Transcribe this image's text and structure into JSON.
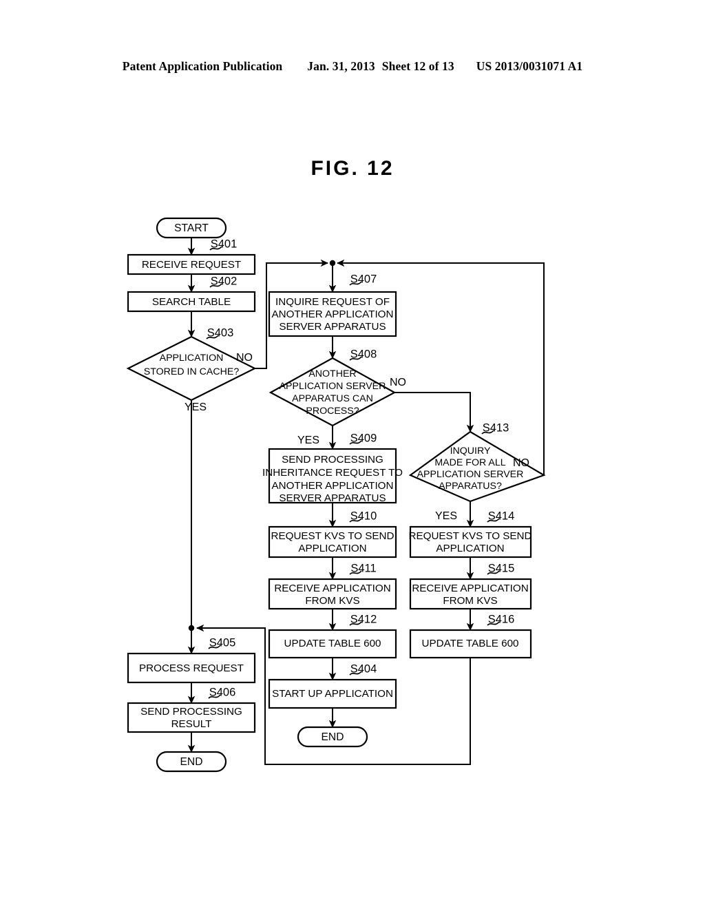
{
  "header": {
    "publication": "Patent Application Publication",
    "date": "Jan. 31, 2013",
    "sheet": "Sheet 12 of 13",
    "pub_number": "US 2013/0031071 A1"
  },
  "figure": {
    "title": "FIG. 12"
  },
  "flowchart": {
    "terminals": {
      "start": "START",
      "end_left": "END",
      "end_middle": "END"
    },
    "yes_no": {
      "yes": "YES",
      "no": "NO"
    },
    "nodes": [
      {
        "id": "S401",
        "step": "S401",
        "type": "process",
        "lines": [
          "RECEIVE REQUEST"
        ]
      },
      {
        "id": "S402",
        "step": "S402",
        "type": "process",
        "lines": [
          "SEARCH TABLE"
        ]
      },
      {
        "id": "S403",
        "step": "S403",
        "type": "decision",
        "lines": [
          "APPLICATION",
          "STORED IN CACHE?"
        ]
      },
      {
        "id": "S405",
        "step": "S405",
        "type": "process",
        "lines": [
          "PROCESS REQUEST"
        ]
      },
      {
        "id": "S406",
        "step": "S406",
        "type": "process",
        "lines": [
          "SEND PROCESSING",
          "RESULT"
        ]
      },
      {
        "id": "S407",
        "step": "S407",
        "type": "process",
        "lines": [
          "INQUIRE REQUEST OF",
          "ANOTHER APPLICATION",
          "SERVER APPARATUS"
        ]
      },
      {
        "id": "S408",
        "step": "S408",
        "type": "decision",
        "lines": [
          "ANOTHER",
          "APPLICATION SERVER",
          "APPARATUS CAN",
          "PROCESS?"
        ]
      },
      {
        "id": "S409",
        "step": "S409",
        "type": "process",
        "lines": [
          "SEND PROCESSING",
          "INHERITANCE REQUEST TO",
          "ANOTHER APPLICATION",
          "SERVER APPARATUS"
        ]
      },
      {
        "id": "S410",
        "step": "S410",
        "type": "process",
        "lines": [
          "REQUEST KVS TO SEND",
          "APPLICATION"
        ]
      },
      {
        "id": "S411",
        "step": "S411",
        "type": "process",
        "lines": [
          "RECEIVE APPLICATION",
          "FROM KVS"
        ]
      },
      {
        "id": "S412",
        "step": "S412",
        "type": "process",
        "lines": [
          "UPDATE TABLE 600"
        ]
      },
      {
        "id": "S404",
        "step": "S404",
        "type": "process",
        "lines": [
          "START UP APPLICATION"
        ]
      },
      {
        "id": "S413",
        "step": "S413",
        "type": "decision",
        "lines": [
          "INQUIRY",
          "MADE FOR ALL",
          "APPLICATION SERVER",
          "APPARATUS?"
        ]
      },
      {
        "id": "S414",
        "step": "S414",
        "type": "process",
        "lines": [
          "REQUEST KVS TO SEND",
          "APPLICATION"
        ]
      },
      {
        "id": "S415",
        "step": "S415",
        "type": "process",
        "lines": [
          "RECEIVE APPLICATION",
          "FROM KVS"
        ]
      },
      {
        "id": "S416",
        "step": "S416",
        "type": "process",
        "lines": [
          "UPDATE TABLE 600"
        ]
      }
    ],
    "edge_labels": {
      "s403_no": "NO",
      "s403_yes": "YES",
      "s408_no": "NO",
      "s408_yes": "YES",
      "s413_no": "NO",
      "s413_yes": "YES"
    }
  }
}
